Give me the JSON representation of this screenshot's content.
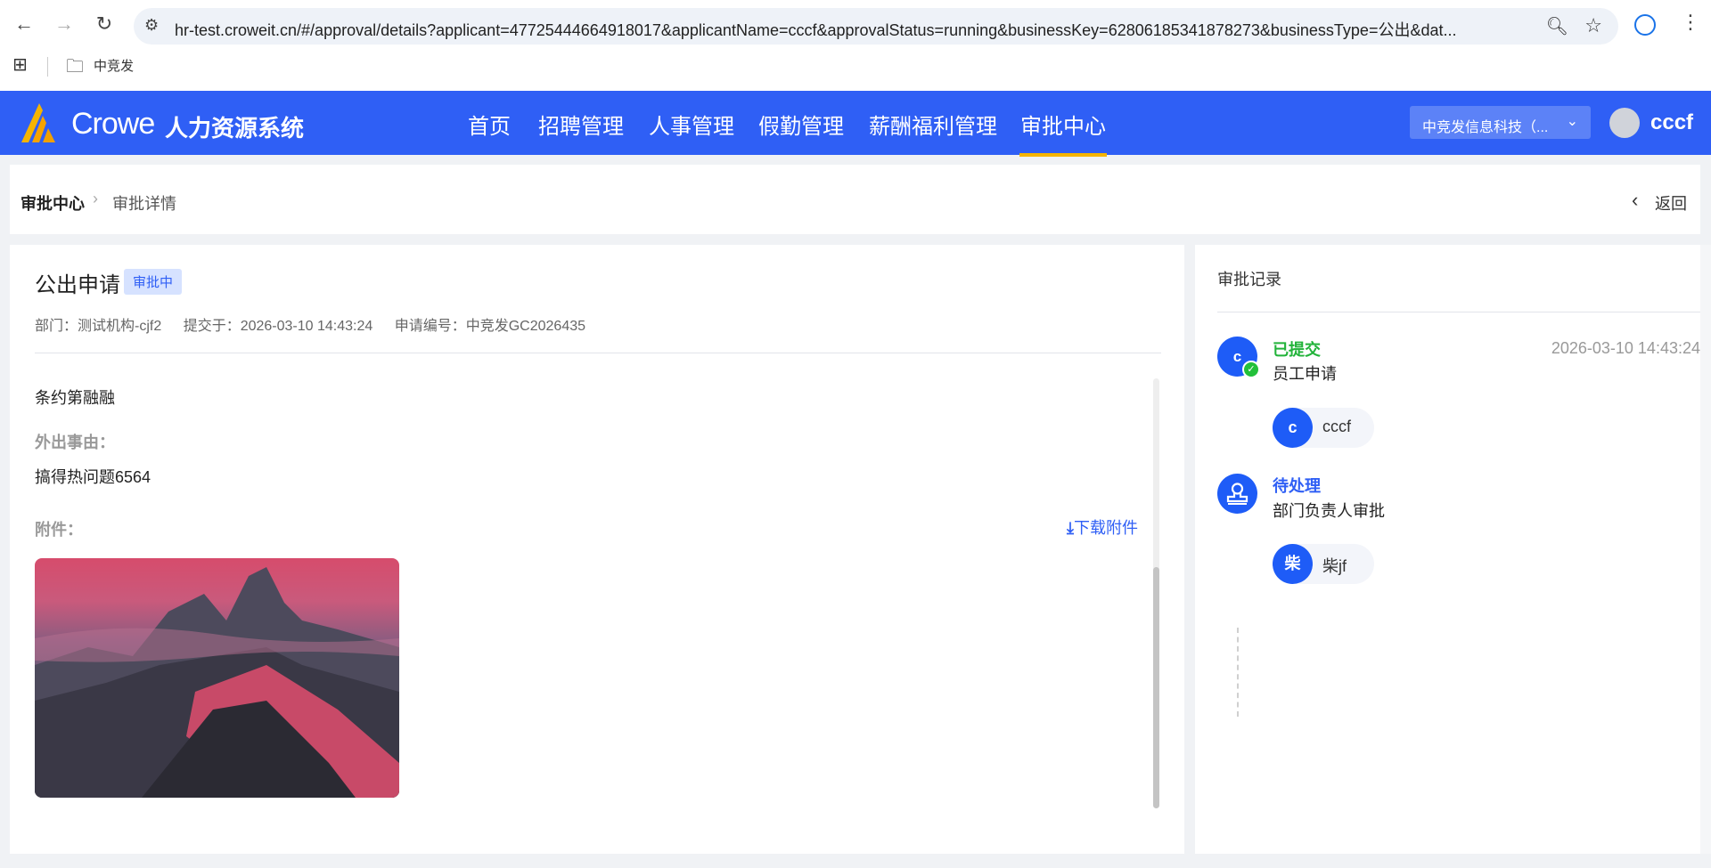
{
  "browser": {
    "url": "hr-test.croweit.cn/#/approval/details?applicant=47725444664918017&applicantName=cccf&approvalStatus=running&businessKey=62806185341878273&businessType=公出&dat...",
    "bookmark": "中竞发"
  },
  "header": {
    "brand": "Crowe",
    "system": "人力资源系统",
    "nav": [
      "首页",
      "招聘管理",
      "人事管理",
      "假勤管理",
      "薪酬福利管理",
      "审批中心"
    ],
    "active_nav": "审批中心",
    "org": "中竞发信息科技（...",
    "user": "cccf",
    "brand_color": "#2f5ff5"
  },
  "breadcrumb": {
    "root": "审批中心",
    "current": "审批详情",
    "back": "返回"
  },
  "detail": {
    "title": "公出申请",
    "status": "审批中",
    "dept": "部门：测试机构-cjf2",
    "submitted": "提交于：2026-03-10 14:43:24",
    "number": "申请编号：中竞发GC2026435",
    "content": "条约第融融",
    "reason_label": "外出事由：",
    "reason": "搞得热问题6564",
    "attach_label": "附件：",
    "download": "下载附件"
  },
  "record": {
    "title": "审批记录",
    "steps": [
      {
        "status": "已提交",
        "status_color": "#22b33a",
        "node": "employee-application",
        "node_label": "c",
        "desc": "员工申请",
        "time": "2026-03-10 14:43:24",
        "person_avatar": "c",
        "person": "cccf"
      },
      {
        "status": "待处理",
        "status_color": "#2f5ff5",
        "node": "stamp",
        "desc": "部门负责人审批",
        "person_avatar": "柴",
        "person": "柴jf"
      }
    ]
  }
}
